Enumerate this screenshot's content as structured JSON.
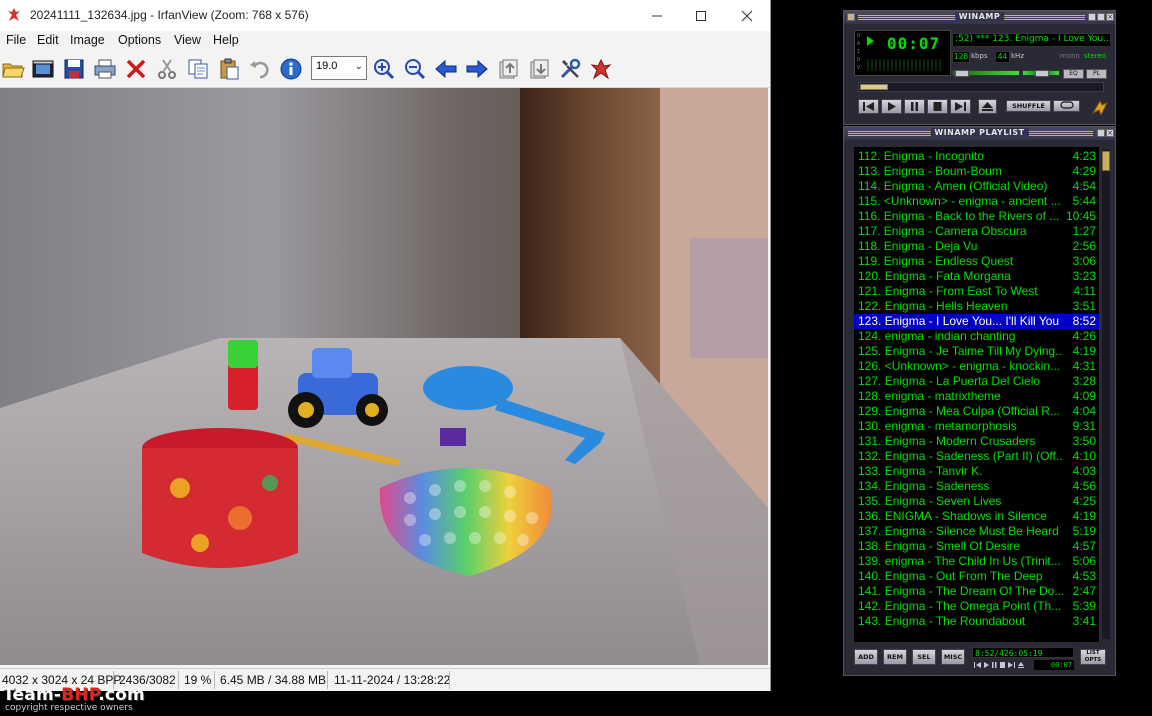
{
  "irfanview": {
    "title": "20241111_132634.jpg - IrfanView (Zoom: 768 x 576)",
    "menu": [
      "File",
      "Edit",
      "Image",
      "Options",
      "View",
      "Help"
    ],
    "zoom_value": "19.0",
    "toolbar_icons": [
      "open-folder-icon",
      "slideshow-icon",
      "save-icon",
      "print-icon",
      "delete-icon",
      "cut-icon",
      "copy-icon",
      "paste-icon",
      "undo-icon",
      "info-icon",
      "zoom-in-icon",
      "zoom-out-icon",
      "previous-icon",
      "next-icon",
      "first-page-icon",
      "last-page-icon",
      "settings-icon",
      "irfanview-logo-icon"
    ],
    "status": {
      "dimensions": "4032 x 3024 x 24 BPP",
      "index": "2436/3082",
      "zoom": "19 %",
      "size": "6.45 MB / 34.88 MB",
      "datetime": "11-11-2024 / 13:28:22"
    }
  },
  "watermark": {
    "logo_prefix": "Team-",
    "logo_bhp": "BHP",
    "logo_suffix": ".com",
    "sub": "copyright respective owners"
  },
  "winamp": {
    "title": "WINAMP",
    "time": "00:07",
    "marquee": ":52)  ***  123. Enigma - I Love You...",
    "kbps": "128",
    "kbps_label": "kbps",
    "khz": "44",
    "khz_label": "kHz",
    "mono_label": "mono",
    "stereo_label": "stereo",
    "eq_label": "EQ",
    "pl_label": "PL",
    "shuffle_label": "SHUFFLE",
    "side_labels": [
      "O",
      "A",
      "I",
      "D",
      "V"
    ]
  },
  "playlist": {
    "title": "WINAMP PLAYLIST",
    "selected_index": 11,
    "items": [
      {
        "title": "112. Enigma - Incognito",
        "dur": "4:23"
      },
      {
        "title": "113. Enigma - Boum-Boum",
        "dur": "4:29"
      },
      {
        "title": "114. Enigma - Amen (Official Video)",
        "dur": "4:54"
      },
      {
        "title": "115. <Unknown> - enigma - ancient ...",
        "dur": "5:44"
      },
      {
        "title": "116. Enigma - Back to the Rivers of ...",
        "dur": "10:45"
      },
      {
        "title": "117. Enigma - Camera Obscura",
        "dur": "1:27"
      },
      {
        "title": "118. Enigma - Deja Vu",
        "dur": "2:56"
      },
      {
        "title": "119. Enigma - Endless Quest",
        "dur": "3:06"
      },
      {
        "title": "120. Enigma - Fata Morgana",
        "dur": "3:23"
      },
      {
        "title": "121. Enigma - From East To West",
        "dur": "4:11"
      },
      {
        "title": "122. Enigma - Hells Heaven",
        "dur": "3:51"
      },
      {
        "title": "123. Enigma - I Love You... I'll Kill You",
        "dur": "8:52"
      },
      {
        "title": "124. enigma - indian chanting",
        "dur": "4:26"
      },
      {
        "title": "125. Enigma - Je Taime Till My Dying...",
        "dur": "4:19"
      },
      {
        "title": "126. <Unknown> - enigma - knockin...",
        "dur": "4:31"
      },
      {
        "title": "127. Enigma - La Puerta Del Cielo",
        "dur": "3:28"
      },
      {
        "title": "128. enigma - matrixtheme",
        "dur": "4:09"
      },
      {
        "title": "129. Enigma - Mea Culpa (Official R...",
        "dur": "4:04"
      },
      {
        "title": "130. enigma - metamorphosis",
        "dur": "9:31"
      },
      {
        "title": "131. Enigma - Modern Crusaders",
        "dur": "3:50"
      },
      {
        "title": "132. Enigma - Sadeness (Part II) (Off...",
        "dur": "4:10"
      },
      {
        "title": "133. Enigma - Tanvir K.",
        "dur": "4:03"
      },
      {
        "title": "134. Enigma - Sadeness",
        "dur": "4:56"
      },
      {
        "title": "135. Enigma - Seven Lives",
        "dur": "4:25"
      },
      {
        "title": "136. ENIGMA - Shadows in Silence",
        "dur": "4:19"
      },
      {
        "title": "137. Enigma - Silence Must Be Heard",
        "dur": "5:19"
      },
      {
        "title": "138. Enigma - Smell Of Desire",
        "dur": "4:57"
      },
      {
        "title": "139. enigma - The Child In Us (Trinit...",
        "dur": "5:06"
      },
      {
        "title": "140. Enigma - Out From The Deep",
        "dur": "4:53"
      },
      {
        "title": "141. Enigma - The Dream Of The Do...",
        "dur": "2:47"
      },
      {
        "title": "142. Enigma - The Omega Point (Th...",
        "dur": "5:39"
      },
      {
        "title": "143. Enigma - The Roundabout",
        "dur": "3:41"
      }
    ],
    "buttons": {
      "add": "ADD",
      "rem": "REM",
      "sel": "SEL",
      "misc": "MISC",
      "list": "LIST OPTS"
    },
    "time_info": "8:52/426:05:19",
    "mini_time": "00:07"
  }
}
